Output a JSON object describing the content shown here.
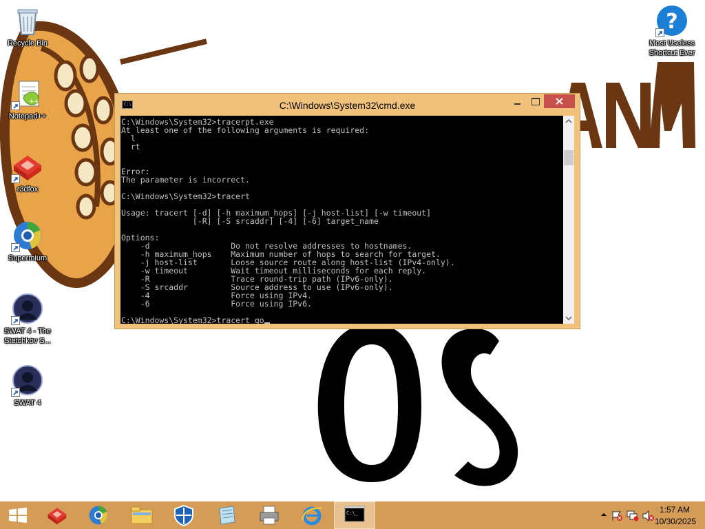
{
  "desktop": {
    "icons": [
      {
        "label": "Recycle Bin",
        "icon": "recycle-bin-icon"
      },
      {
        "label": "Notepad++",
        "icon": "notepad-plus-plus-icon"
      },
      {
        "label": "r3dfox",
        "icon": "r3dfox-icon"
      },
      {
        "label": "Supermium",
        "icon": "supermium-icon"
      },
      {
        "label": "SWAT 4 - The Stetchkov S...",
        "icon": "swat4-stetchkov-icon"
      },
      {
        "label": "SWAT 4",
        "icon": "swat4-icon"
      },
      {
        "label": "Most Useless Shortcut Ever",
        "icon": "question-mark-icon"
      }
    ]
  },
  "cmd_window": {
    "title": "C:\\Windows\\System32\\cmd.exe",
    "console_lines": [
      "C:\\Windows\\System32>tracerpt.exe",
      "At least one of the following arguments is required:",
      "  l",
      "  rt",
      "",
      "",
      "Error:",
      "The parameter is incorrect.",
      "",
      "C:\\Windows\\System32>tracert",
      "",
      "Usage: tracert [-d] [-h maximum_hops] [-j host-list] [-w timeout]",
      "               [-R] [-S srcaddr] [-4] [-6] target_name",
      "",
      "Options:",
      "    -d                 Do not resolve addresses to hostnames.",
      "    -h maximum_hops    Maximum number of hops to search for target.",
      "    -j host-list       Loose source route along host-list (IPv4-only).",
      "    -w timeout         Wait timeout milliseconds for each reply.",
      "    -R                 Trace round-trip path (IPv6-only).",
      "    -S srcaddr         Source address to use (IPv6-only).",
      "    -4                 Force using IPv4.",
      "    -6                 Force using IPv6.",
      "",
      "C:\\Windows\\System32>tracert go"
    ]
  },
  "taskbar": {
    "items": [
      {
        "icon": "windows-start-icon"
      },
      {
        "icon": "r3dfox-icon"
      },
      {
        "icon": "supermium-icon"
      },
      {
        "icon": "file-explorer-icon"
      },
      {
        "icon": "shield-icon"
      },
      {
        "icon": "notepad-icon"
      },
      {
        "icon": "printer-icon"
      },
      {
        "icon": "internet-explorer-icon"
      },
      {
        "icon": "command-prompt-icon"
      }
    ],
    "clock_time": "1:57 AM",
    "clock_date": "10/30/2025"
  },
  "wallpaper": {
    "text": "OS"
  },
  "colors": {
    "taskbar": "#d49c56",
    "window_frame": "#f0c27b",
    "close_button": "#c7504a",
    "console_bg": "#000000",
    "console_text": "#c0c0c0"
  }
}
